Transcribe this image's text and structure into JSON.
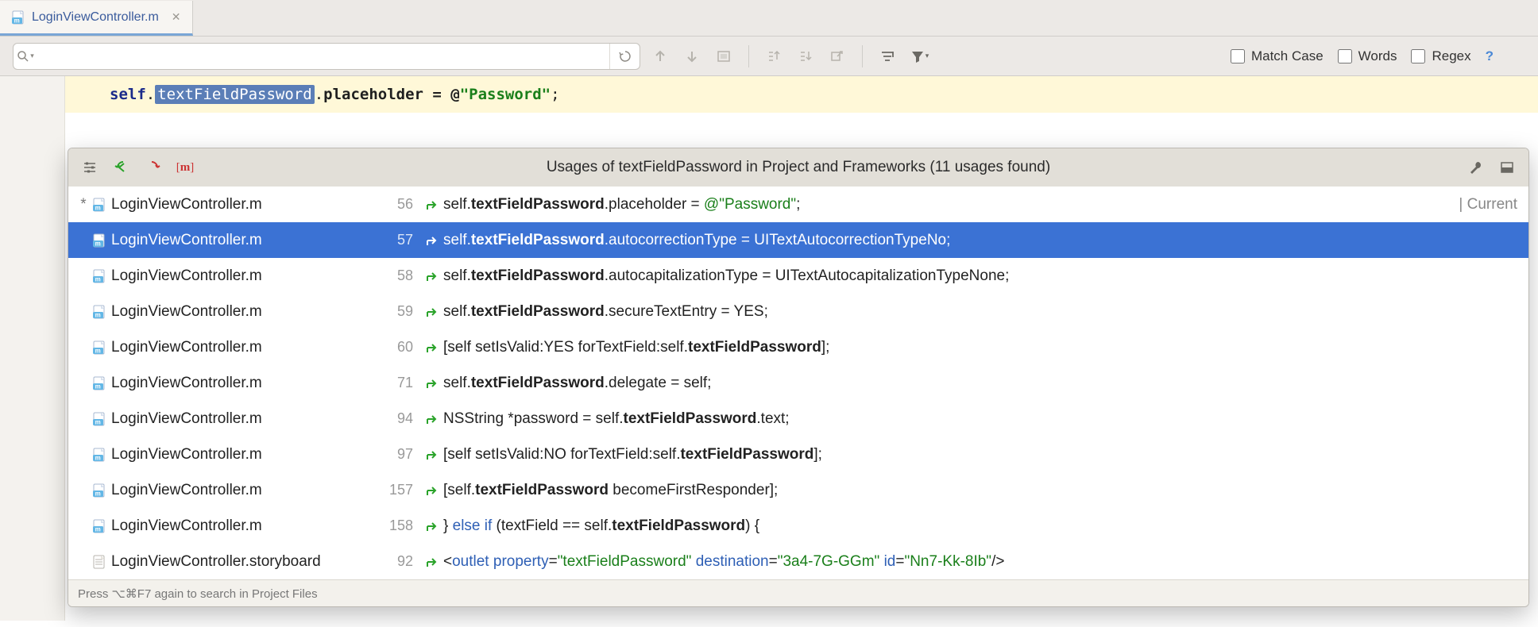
{
  "tab": {
    "filename": "LoginViewController.m"
  },
  "toolbar": {
    "search_value": "",
    "match_case": "Match Case",
    "words": "Words",
    "regex": "Regex"
  },
  "code": {
    "kw": "self",
    "dot1": ".",
    "highlighted": "textFieldPassword",
    "dot2": ".",
    "prop": "placeholder = @",
    "str": "\"Password\"",
    "semi": ";"
  },
  "popup": {
    "title": "Usages of textFieldPassword in Project and Frameworks (11 usages found)",
    "footer": "Press ⌥⌘F7 again to search in Project Files",
    "current_label": "| Current",
    "rows": [
      {
        "star": "*",
        "file": "LoginViewController.m",
        "line": "56",
        "code": [
          [
            "",
            "self."
          ],
          [
            "b",
            "textFieldPassword"
          ],
          [
            "",
            ".placeholder = "
          ],
          [
            "g",
            "@\"Password\""
          ],
          [
            "",
            ";"
          ]
        ],
        "current": true,
        "selected": false
      },
      {
        "star": "",
        "file": "LoginViewController.m",
        "line": "57",
        "code": [
          [
            "",
            "self."
          ],
          [
            "b",
            "textFieldPassword"
          ],
          [
            "",
            ".autocorrectionType = UITextAutocorrectionTypeNo;"
          ]
        ],
        "current": false,
        "selected": true
      },
      {
        "star": "",
        "file": "LoginViewController.m",
        "line": "58",
        "code": [
          [
            "",
            "self."
          ],
          [
            "b",
            "textFieldPassword"
          ],
          [
            "",
            ".autocapitalizationType = UITextAutocapitalizationTypeNone;"
          ]
        ],
        "current": false,
        "selected": false
      },
      {
        "star": "",
        "file": "LoginViewController.m",
        "line": "59",
        "code": [
          [
            "",
            "self."
          ],
          [
            "b",
            "textFieldPassword"
          ],
          [
            "",
            ".secureTextEntry = YES;"
          ]
        ],
        "current": false,
        "selected": false
      },
      {
        "star": "",
        "file": "LoginViewController.m",
        "line": "60",
        "code": [
          [
            "",
            "[self setIsValid:YES forTextField:self."
          ],
          [
            "b",
            "textFieldPassword"
          ],
          [
            "",
            "];"
          ]
        ],
        "current": false,
        "selected": false
      },
      {
        "star": "",
        "file": "LoginViewController.m",
        "line": "71",
        "code": [
          [
            "",
            "self."
          ],
          [
            "b",
            "textFieldPassword"
          ],
          [
            "",
            ".delegate = self;"
          ]
        ],
        "current": false,
        "selected": false
      },
      {
        "star": "",
        "file": "LoginViewController.m",
        "line": "94",
        "code": [
          [
            "",
            "NSString *password = self."
          ],
          [
            "b",
            "textFieldPassword"
          ],
          [
            "",
            ".text;"
          ]
        ],
        "current": false,
        "selected": false
      },
      {
        "star": "",
        "file": "LoginViewController.m",
        "line": "97",
        "code": [
          [
            "",
            "[self setIsValid:NO forTextField:self."
          ],
          [
            "b",
            "textFieldPassword"
          ],
          [
            "",
            "];"
          ]
        ],
        "current": false,
        "selected": false
      },
      {
        "star": "",
        "file": "LoginViewController.m",
        "line": "157",
        "code": [
          [
            "",
            "[self."
          ],
          [
            "b",
            "textFieldPassword"
          ],
          [
            "",
            " becomeFirstResponder];"
          ]
        ],
        "current": false,
        "selected": false
      },
      {
        "star": "",
        "file": "LoginViewController.m",
        "line": "158",
        "code": [
          [
            "",
            "} "
          ],
          [
            "bl",
            "else if"
          ],
          [
            "",
            " (textField == self."
          ],
          [
            "b",
            "textFieldPassword"
          ],
          [
            "",
            ") {"
          ]
        ],
        "current": false,
        "selected": false
      },
      {
        "star": "",
        "file": "LoginViewController.storyboard",
        "line": "92",
        "code": [
          [
            "",
            "<"
          ],
          [
            "bl",
            "outlet"
          ],
          [
            "",
            " "
          ],
          [
            "bl",
            "property"
          ],
          [
            "",
            "="
          ],
          [
            "g",
            "\"textFieldPassword\""
          ],
          [
            "",
            " "
          ],
          [
            "bl",
            "destination"
          ],
          [
            "",
            "="
          ],
          [
            "g",
            "\"3a4-7G-GGm\""
          ],
          [
            "",
            " "
          ],
          [
            "bl",
            "id"
          ],
          [
            "",
            "="
          ],
          [
            "g",
            "\"Nn7-Kk-8Ib\""
          ],
          [
            "",
            "/>"
          ]
        ],
        "current": false,
        "selected": false,
        "storyboard": true
      }
    ]
  }
}
